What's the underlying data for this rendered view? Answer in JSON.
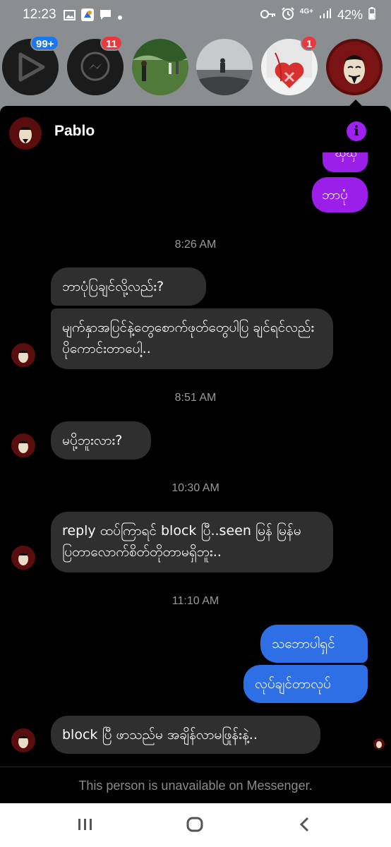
{
  "status_bar": {
    "time": "12:23",
    "network": "4G+",
    "battery": "42%"
  },
  "chat_heads": [
    {
      "name": "video-chathead",
      "badge": "99+",
      "badge_color": "#1877f2"
    },
    {
      "name": "messenger-chathead",
      "badge": "11",
      "badge_color": "#e8393f"
    },
    {
      "name": "people-outdoors-chathead"
    },
    {
      "name": "sunset-person-chathead"
    },
    {
      "name": "heart-chathead",
      "badge": "1",
      "badge_color": "#e8393f"
    },
    {
      "name": "mask-chathead"
    }
  ],
  "chat": {
    "contact_name": "Pablo",
    "messages": [
      {
        "type": "out",
        "text": "ဘာပုံ",
        "color": "#9b1fe8"
      },
      {
        "type": "time",
        "text": "8:26 AM"
      },
      {
        "type": "in",
        "text": "ဘာပုံပြချင်လို့လည်း?"
      },
      {
        "type": "in",
        "text": "မျက်နှာအပြင်နဲ့တွေစောက်ဖုတ်တွေပါပြ ချင်ရင်လည်းပိုကောင်းတာပေါ့.."
      },
      {
        "type": "time",
        "text": "8:51 AM"
      },
      {
        "type": "in",
        "text": "မပို့ဘူးလား?"
      },
      {
        "type": "time",
        "text": "10:30 AM"
      },
      {
        "type": "in",
        "text": "reply ထပ်ကြာရင် block ပြီ..seen မြန် မြန်မပြတာလောက်စိတ်တိုတာမရှိဘူး.."
      },
      {
        "type": "time",
        "text": "11:10 AM"
      },
      {
        "type": "out",
        "text": "သဘောပါရှင်",
        "color": "#2f6fe6"
      },
      {
        "type": "out",
        "text": "လုပ်ချင်တာလုပ်",
        "color": "#2f6fe6"
      },
      {
        "type": "in",
        "text": "block ပြီ ဖာသည်မ အချိန်လာမဖြုန်းနဲ့.."
      }
    ],
    "footer_notice": "This person is unavailable on Messenger."
  }
}
